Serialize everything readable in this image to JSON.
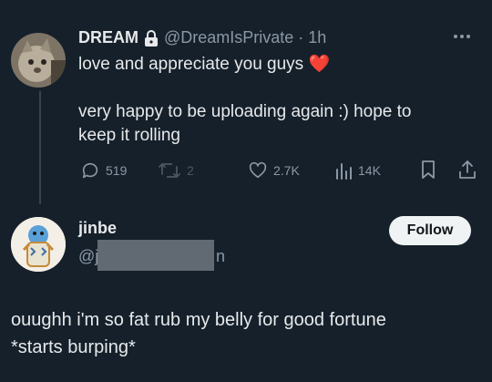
{
  "tweet": {
    "display_name": "DREAM",
    "handle_time": "@DreamIsPrivate · 1h",
    "line1": "love and appreciate you guys",
    "emoji": "❤️",
    "line2": "very happy to be uploading again :) hope to",
    "line3": "keep it rolling",
    "more_icon": "more-dots-icon",
    "lock_icon": "lock-icon",
    "actions": {
      "replies": "519",
      "retweets": "2",
      "likes": "2.7K",
      "views": "14K"
    }
  },
  "reply": {
    "display_name": "jinbe",
    "handle_visible": "@j",
    "handle_tail": "n",
    "follow_label": "Follow",
    "line1": "ouughh i'm so fat rub my belly for good fortune",
    "line2": "*starts burping*"
  },
  "colors": {
    "background": "#15202b",
    "text": "#e7e9ea",
    "muted": "#8b98a5",
    "heart": "#f91880",
    "follow_bg": "#eff3f4",
    "thread_line": "#38444d"
  }
}
